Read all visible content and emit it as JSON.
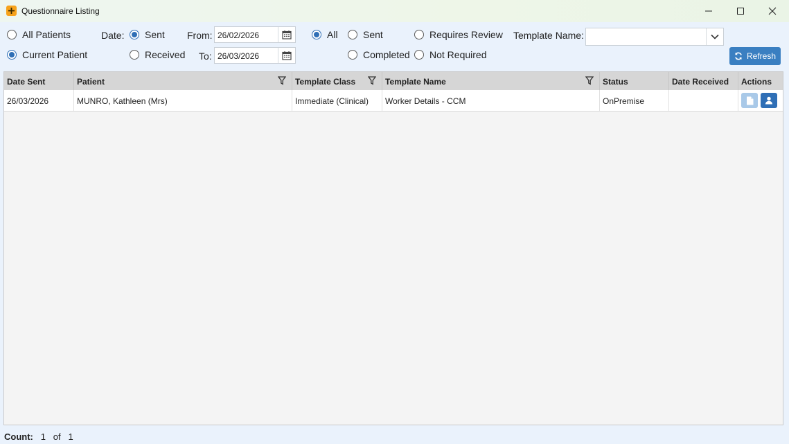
{
  "window": {
    "title": "Questionnaire Listing",
    "controls": [
      "minimize",
      "maximize",
      "close"
    ]
  },
  "filters": {
    "patient_scope": {
      "options": [
        {
          "label": "All Patients",
          "checked": false
        },
        {
          "label": "Current Patient",
          "checked": true
        }
      ]
    },
    "date_label": "Date:",
    "date_type": {
      "options": [
        {
          "label": "Sent",
          "checked": true
        },
        {
          "label": "Received",
          "checked": false
        }
      ]
    },
    "from_label": "From:",
    "from_value": "26/02/2026",
    "to_label": "To:",
    "to_value": "26/03/2026",
    "status": {
      "options": [
        {
          "label": "All",
          "checked": true
        },
        {
          "label": "Sent",
          "checked": false
        },
        {
          "label": "Requires Review",
          "checked": false
        },
        {
          "label": "Completed",
          "checked": false
        },
        {
          "label": "Not Required",
          "checked": false
        }
      ]
    },
    "template_name_label": "Template Name:",
    "template_name_value": "",
    "refresh_label": "Refresh"
  },
  "table": {
    "columns": [
      "Date Sent",
      "Patient",
      "Template Class",
      "Template Name",
      "Status",
      "Date Received",
      "Actions"
    ],
    "rows": [
      {
        "date_sent": "26/03/2026",
        "patient": "MUNRO, Kathleen (Mrs)",
        "template_class": "Immediate (Clinical)",
        "template_name": "Worker Details - CCM",
        "status": "OnPremise",
        "date_received": ""
      }
    ]
  },
  "footer": {
    "count_label": "Count:",
    "current": "1",
    "of_label": "of",
    "total": "1"
  },
  "colors": {
    "accent": "#3a7fc1",
    "app_icon": "#f7a21b",
    "disabled_button": "#a9c9e8"
  }
}
